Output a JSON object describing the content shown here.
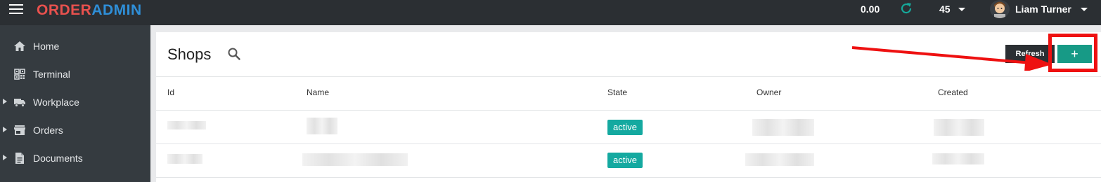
{
  "header": {
    "logo_part1": "ORDER",
    "logo_part2": "ADMIN",
    "balance": "0.00",
    "count": "45",
    "user_name": "Liam Turner"
  },
  "sidebar": {
    "items": [
      {
        "label": "Home",
        "icon": "home-icon",
        "expandable": false
      },
      {
        "label": "Terminal",
        "icon": "qr-code-icon",
        "expandable": false
      },
      {
        "label": "Workplace",
        "icon": "truck-icon",
        "expandable": true
      },
      {
        "label": "Orders",
        "icon": "store-icon",
        "expandable": true
      },
      {
        "label": "Documents",
        "icon": "document-icon",
        "expandable": true
      }
    ]
  },
  "main": {
    "title": "Shops",
    "refresh_label": "Refresh",
    "add_label": "+",
    "table": {
      "columns": [
        "Id",
        "Name",
        "State",
        "Owner",
        "Created"
      ],
      "rows": [
        {
          "state": "active"
        },
        {
          "state": "active"
        }
      ]
    }
  },
  "colors": {
    "topbar": "#2b2f33",
    "sidebar": "#353b40",
    "accent_green": "#179a86",
    "badge": "#14a9a0",
    "logo_red": "#e8514e",
    "logo_blue": "#2f8fd8",
    "annotation_red": "#ee1111"
  }
}
